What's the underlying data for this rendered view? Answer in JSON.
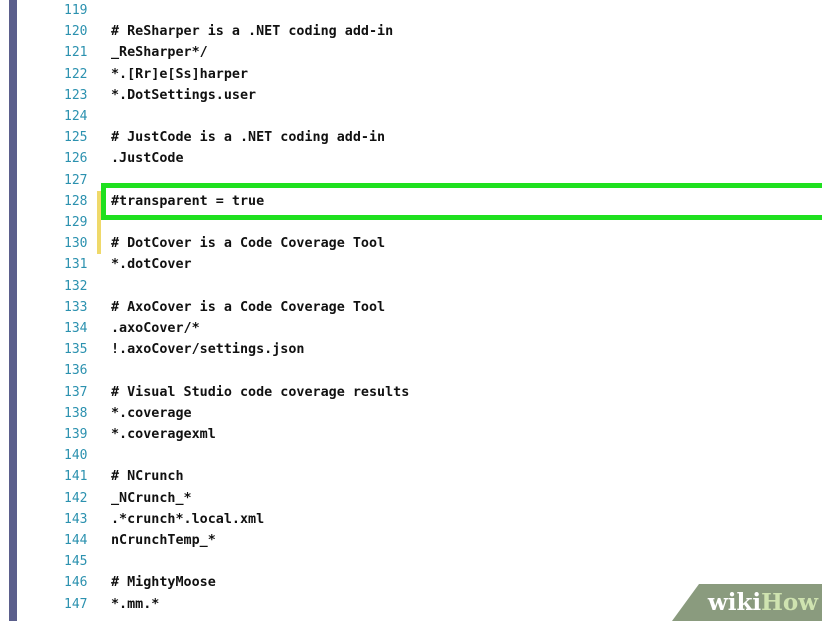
{
  "editor": {
    "lines": [
      {
        "num": "119",
        "text": ""
      },
      {
        "num": "120",
        "text": "# ReSharper is a .NET coding add-in"
      },
      {
        "num": "121",
        "text": "_ReSharper*/"
      },
      {
        "num": "122",
        "text": "*.[Rr]e[Ss]harper"
      },
      {
        "num": "123",
        "text": "*.DotSettings.user"
      },
      {
        "num": "124",
        "text": ""
      },
      {
        "num": "125",
        "text": "# JustCode is a .NET coding add-in"
      },
      {
        "num": "126",
        "text": ".JustCode"
      },
      {
        "num": "127",
        "text": ""
      },
      {
        "num": "128",
        "text": "#transparent = true"
      },
      {
        "num": "129",
        "text": ""
      },
      {
        "num": "130",
        "text": "# DotCover is a Code Coverage Tool"
      },
      {
        "num": "131",
        "text": "*.dotCover"
      },
      {
        "num": "132",
        "text": ""
      },
      {
        "num": "133",
        "text": "# AxoCover is a Code Coverage Tool"
      },
      {
        "num": "134",
        "text": ".axoCover/*"
      },
      {
        "num": "135",
        "text": "!.axoCover/settings.json"
      },
      {
        "num": "136",
        "text": ""
      },
      {
        "num": "137",
        "text": "# Visual Studio code coverage results"
      },
      {
        "num": "138",
        "text": "*.coverage"
      },
      {
        "num": "139",
        "text": "*.coveragexml"
      },
      {
        "num": "140",
        "text": ""
      },
      {
        "num": "141",
        "text": "# NCrunch"
      },
      {
        "num": "142",
        "text": "_NCrunch_*"
      },
      {
        "num": "143",
        "text": ".*crunch*.local.xml"
      },
      {
        "num": "144",
        "text": "nCrunchTemp_*"
      },
      {
        "num": "145",
        "text": ""
      },
      {
        "num": "146",
        "text": "# MightyMoose"
      },
      {
        "num": "147",
        "text": "*.mm.*"
      }
    ],
    "highlighted_line": "128",
    "changed_lines": [
      "128",
      "129",
      "130"
    ]
  },
  "watermark": {
    "part1": "wiki",
    "part2": "How"
  },
  "colors": {
    "line_number": "#2b91af",
    "highlight_border": "#1fe01f",
    "change_marker": "#efd96a",
    "left_bar": "#5b5f8c"
  }
}
